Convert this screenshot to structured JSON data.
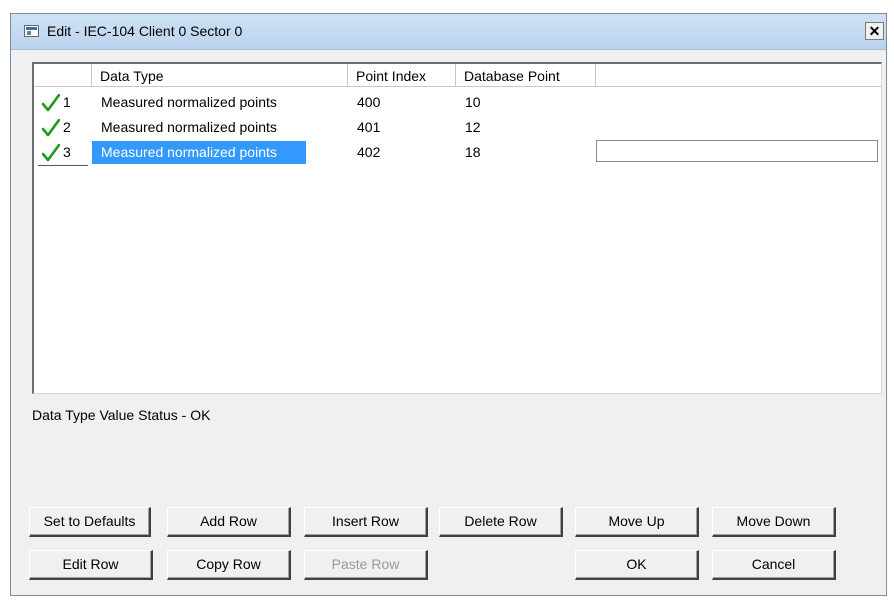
{
  "window": {
    "title": "Edit - IEC-104 Client 0 Sector 0",
    "close_label": "x"
  },
  "table": {
    "columns": [
      "Data Type",
      "Point Index",
      "Database Point"
    ],
    "rows": [
      {
        "num": "1",
        "data_type": "Measured normalized points",
        "point_index": "400",
        "database_point": "10"
      },
      {
        "num": "2",
        "data_type": "Measured normalized points",
        "point_index": "401",
        "database_point": "12"
      },
      {
        "num": "3",
        "data_type": "Measured normalized points",
        "point_index": "402",
        "database_point": "18"
      }
    ],
    "selected_row": 3,
    "check_icon": "check-icon",
    "check_color": "#1f9a1f",
    "selection_color": "#3399ff"
  },
  "status_text": "Data Type Value Status - OK",
  "buttons": {
    "set_defaults": "Set to Defaults",
    "add_row": "Add Row",
    "insert_row": "Insert Row",
    "delete_row": "Delete Row",
    "move_up": "Move Up",
    "move_down": "Move Down",
    "edit_row": "Edit Row",
    "copy_row": "Copy Row",
    "paste_row": "Paste Row",
    "ok": "OK",
    "cancel": "Cancel"
  }
}
